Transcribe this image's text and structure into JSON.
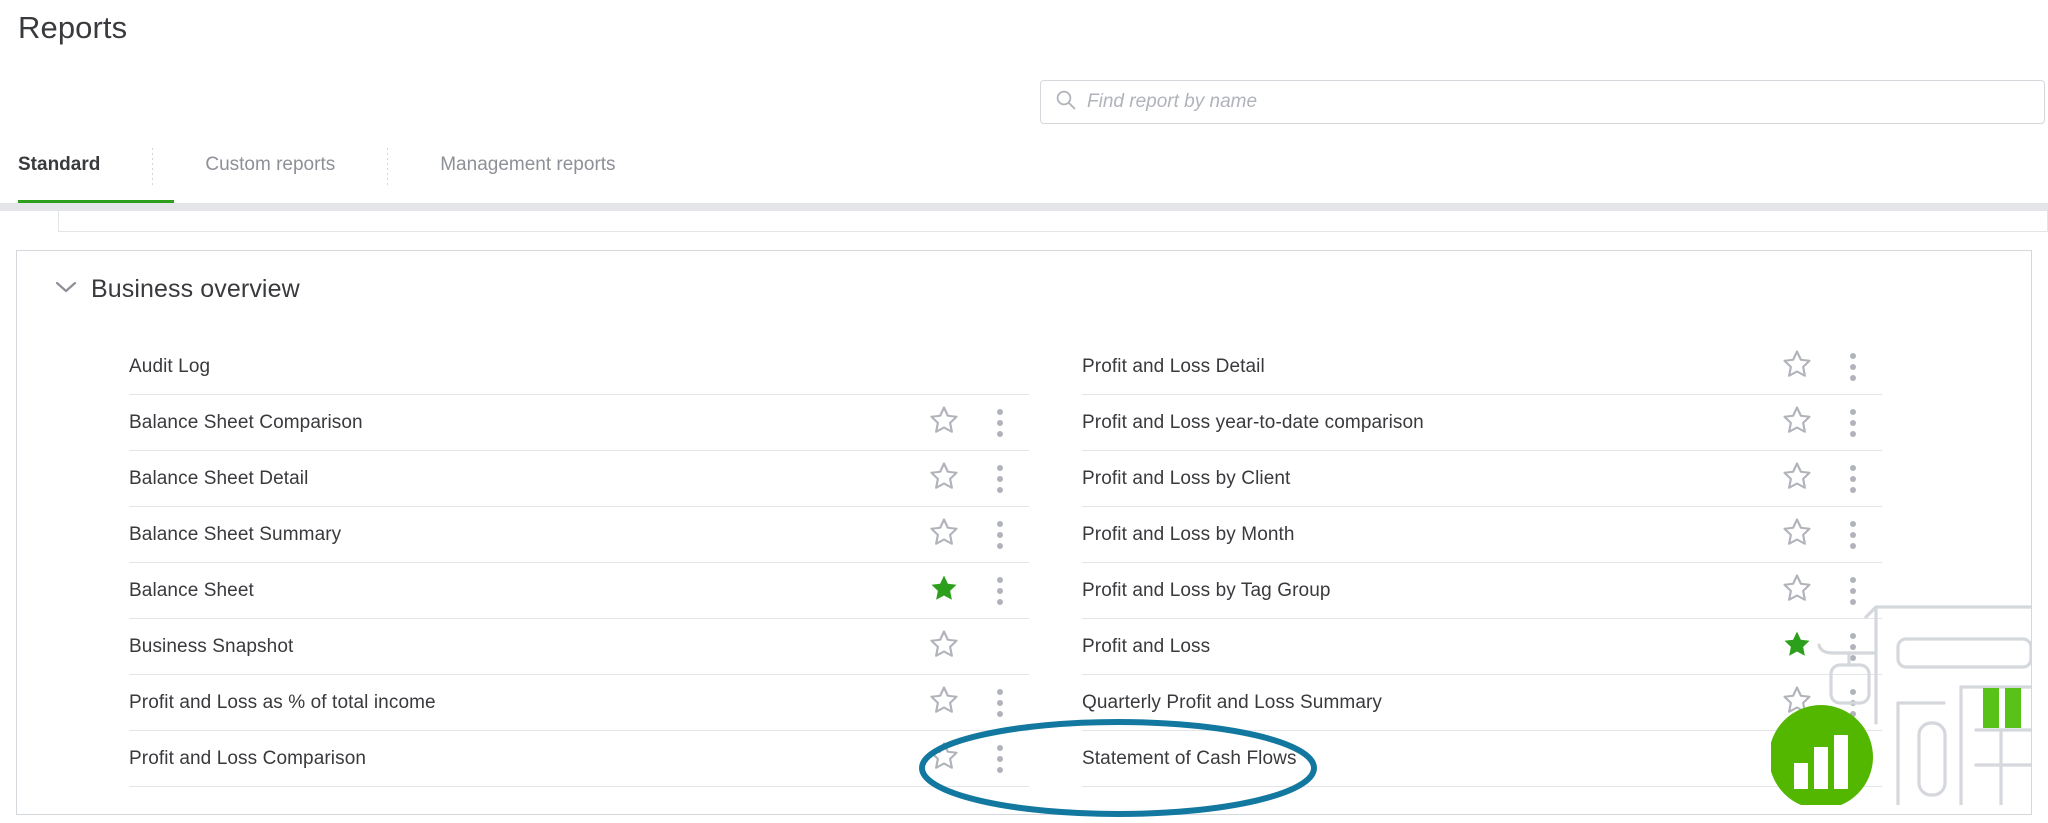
{
  "header": {
    "title": "Reports"
  },
  "search": {
    "placeholder": "Find report by name",
    "value": "",
    "icon": "search-icon"
  },
  "tabs": [
    {
      "label": "Standard",
      "active": true
    },
    {
      "label": "Custom reports",
      "active": false
    },
    {
      "label": "Management reports",
      "active": false
    }
  ],
  "section": {
    "title": "Business overview",
    "expanded": true,
    "chevron_icon": "chevron-down-icon"
  },
  "colors": {
    "accent_green": "#2ca01c",
    "text_primary": "#393a3d",
    "text_muted": "#8d9096",
    "divider": "#e3e5e8",
    "border": "#d4d7dc",
    "star_outline": "#b0b3ba",
    "annotation_teal": "#1278a0"
  },
  "annotation": {
    "shape": "ellipse",
    "target_label": "Statement of Cash Flows",
    "color": "#1278a0"
  },
  "reports": {
    "left_column": [
      {
        "label": "Audit Log",
        "favorite": false,
        "has_star": false,
        "has_menu": false
      },
      {
        "label": "Balance Sheet Comparison",
        "favorite": false,
        "has_star": true,
        "has_menu": true
      },
      {
        "label": "Balance Sheet Detail",
        "favorite": false,
        "has_star": true,
        "has_menu": true
      },
      {
        "label": "Balance Sheet Summary",
        "favorite": false,
        "has_star": true,
        "has_menu": true
      },
      {
        "label": "Balance Sheet",
        "favorite": true,
        "has_star": true,
        "has_menu": true
      },
      {
        "label": "Business Snapshot",
        "favorite": false,
        "has_star": true,
        "has_menu": false
      },
      {
        "label": "Profit and Loss as % of total income",
        "favorite": false,
        "has_star": true,
        "has_menu": true
      },
      {
        "label": "Profit and Loss Comparison",
        "favorite": false,
        "has_star": true,
        "has_menu": true
      }
    ],
    "right_column": [
      {
        "label": "Profit and Loss Detail",
        "favorite": false,
        "has_star": true,
        "has_menu": true
      },
      {
        "label": "Profit and Loss year-to-date comparison",
        "favorite": false,
        "has_star": true,
        "has_menu": true
      },
      {
        "label": "Profit and Loss by Client",
        "favorite": false,
        "has_star": true,
        "has_menu": true
      },
      {
        "label": "Profit and Loss by Month",
        "favorite": false,
        "has_star": true,
        "has_menu": true
      },
      {
        "label": "Profit and Loss by Tag Group",
        "favorite": false,
        "has_star": true,
        "has_menu": true
      },
      {
        "label": "Profit and Loss",
        "favorite": true,
        "has_star": true,
        "has_menu": true
      },
      {
        "label": "Quarterly Profit and Loss Summary",
        "favorite": false,
        "has_star": true,
        "has_menu": true
      },
      {
        "label": "Statement of Cash Flows",
        "favorite": false,
        "has_star": true,
        "has_menu": true
      }
    ]
  },
  "watermark": {
    "name": "reports-illustration",
    "description": "green circle with bar chart and building line art"
  }
}
